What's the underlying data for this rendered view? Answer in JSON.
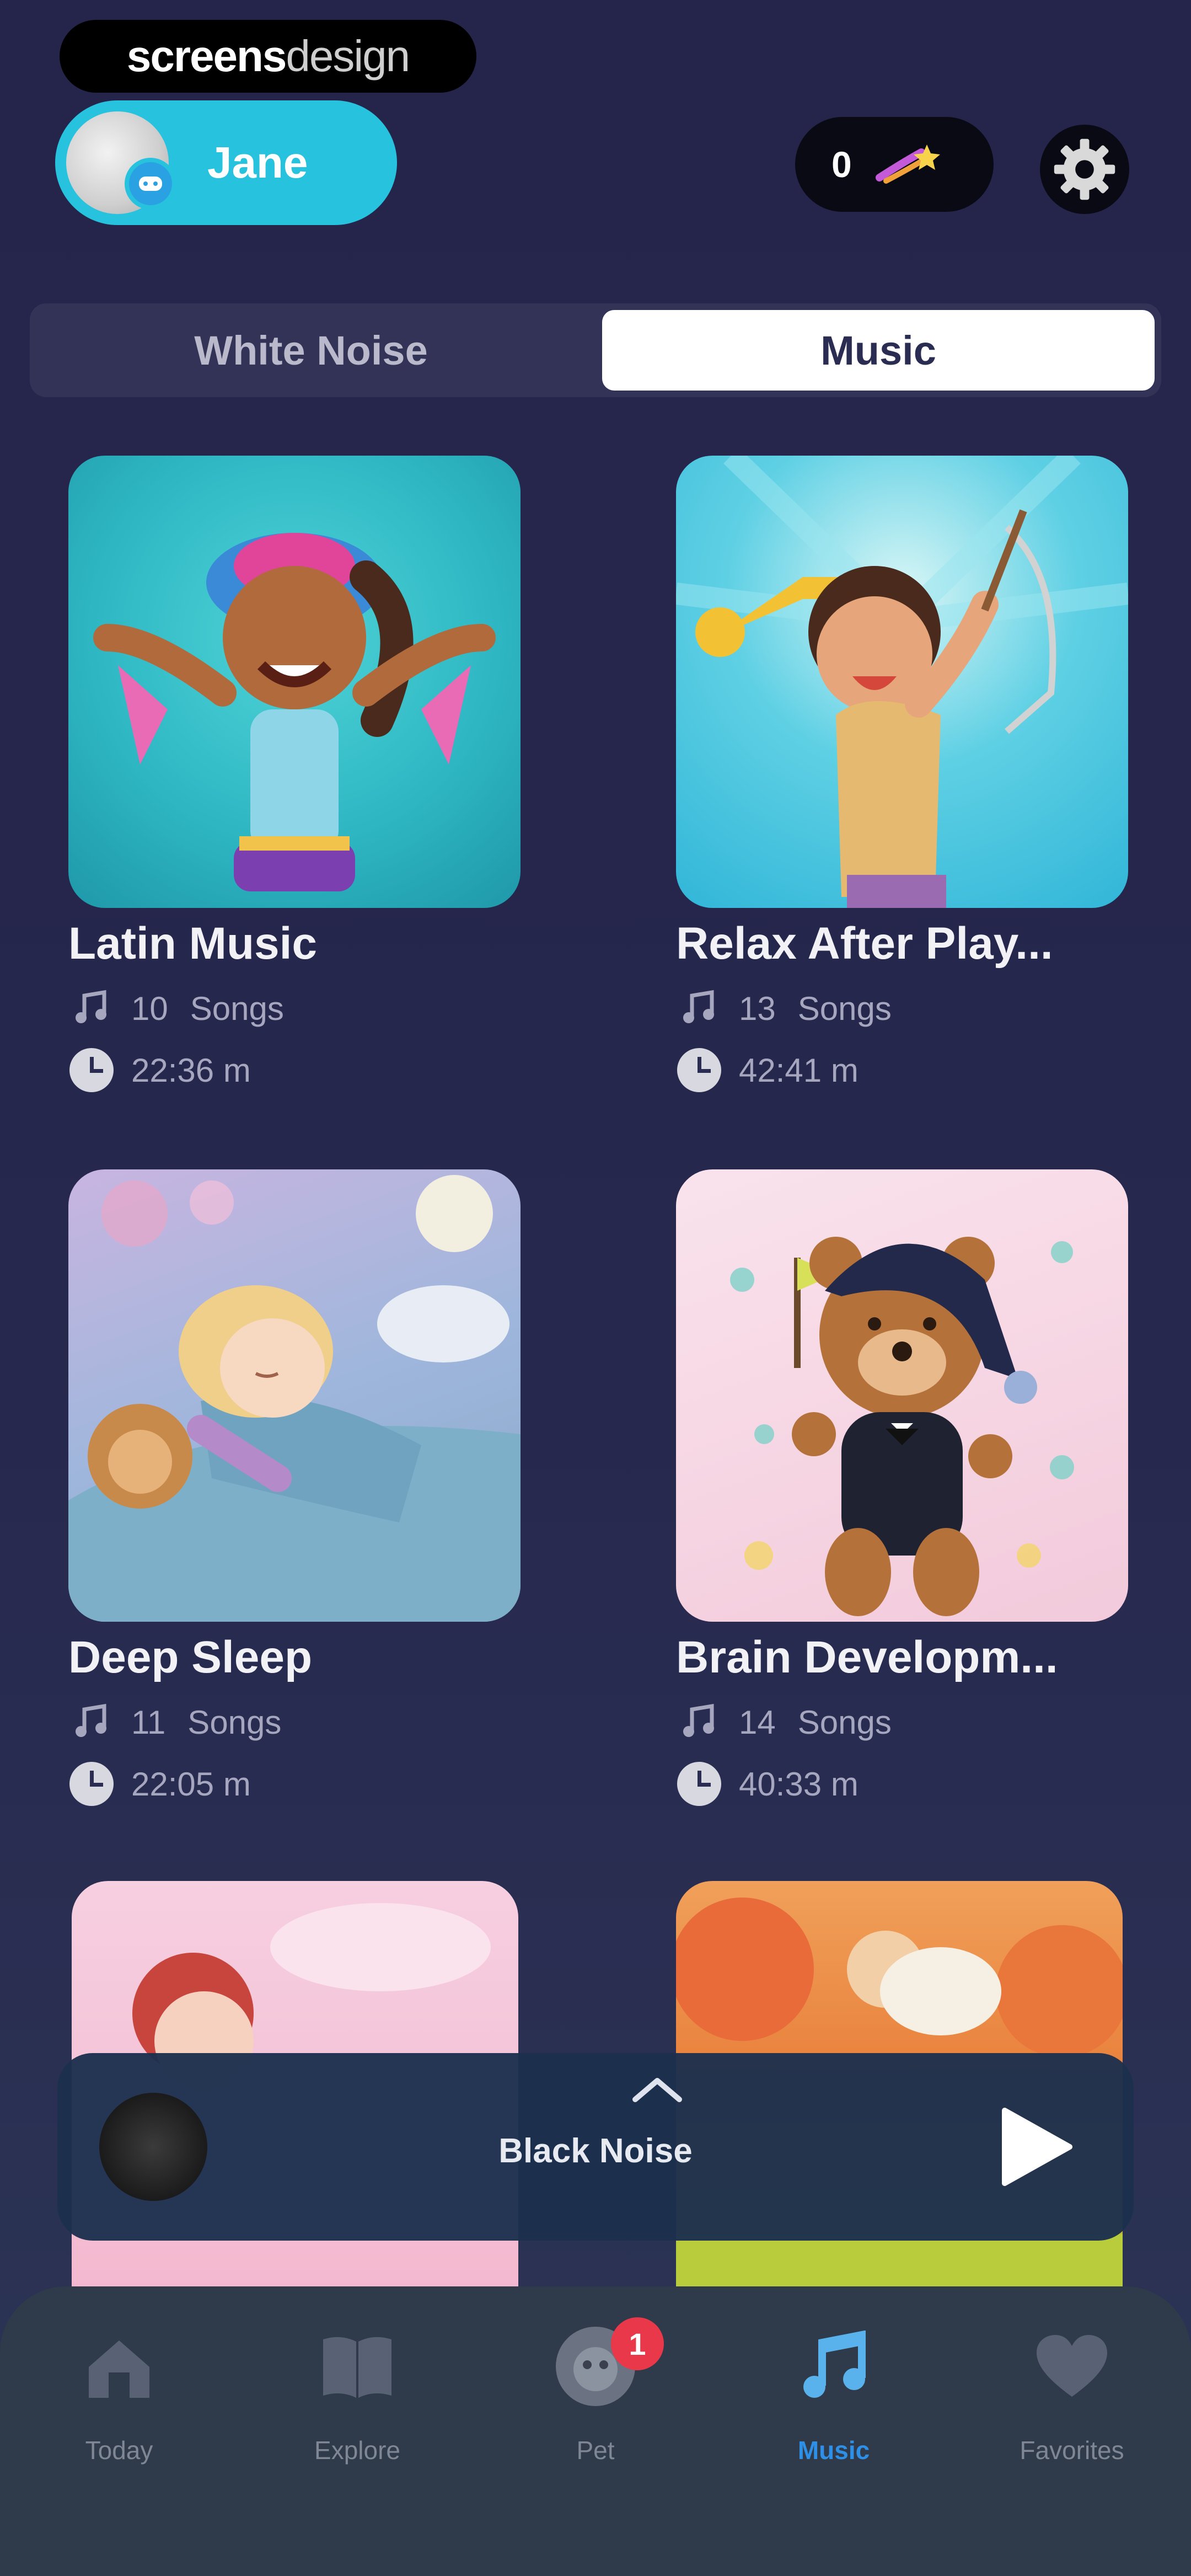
{
  "watermark": {
    "part1": "screens",
    "part2": "design"
  },
  "profile": {
    "name": "Jane"
  },
  "stars": {
    "count": "0"
  },
  "tabs": {
    "white_noise": "White Noise",
    "music": "Music"
  },
  "playlists": [
    {
      "title": "Latin Music",
      "songs": "10",
      "songs_label": "Songs",
      "duration": "22:36 m"
    },
    {
      "title": "Relax After Play...",
      "songs": "13",
      "songs_label": "Songs",
      "duration": "42:41 m"
    },
    {
      "title": "Deep Sleep",
      "songs": "11",
      "songs_label": "Songs",
      "duration": "22:05 m"
    },
    {
      "title": "Brain Developm...",
      "songs": "14",
      "songs_label": "Songs",
      "duration": "40:33 m"
    }
  ],
  "player": {
    "title": "Black Noise"
  },
  "nav": {
    "today": "Today",
    "explore": "Explore",
    "pet": "Pet",
    "pet_badge": "1",
    "music": "Music",
    "favorites": "Favorites"
  },
  "colors": {
    "accent": "#27c2dd",
    "background": "#25244a",
    "active_nav": "#2e8fe6"
  }
}
